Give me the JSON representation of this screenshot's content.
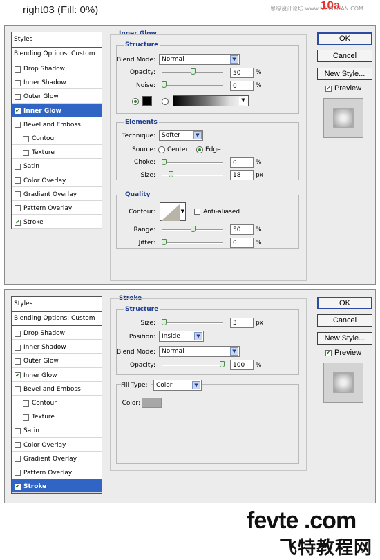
{
  "header": {
    "title": "right03   (Fill: 0%)",
    "watermark": "思缘设计论坛 www.MISSYUAN.COM",
    "number": "10a"
  },
  "colors": {
    "accent": "#3165c5",
    "group_title": "#1f3f8f",
    "check": "#1e6b1e"
  },
  "dialog1": {
    "styles_header": "Styles",
    "blending_options": "Blending Options: Custom",
    "items": [
      {
        "label": "Drop Shadow",
        "checked": false,
        "selected": false
      },
      {
        "label": "Inner Shadow",
        "checked": false,
        "selected": false
      },
      {
        "label": "Outer Glow",
        "checked": false,
        "selected": false
      },
      {
        "label": "Inner Glow",
        "checked": true,
        "selected": true
      },
      {
        "label": "Bevel and Emboss",
        "checked": false,
        "selected": false
      },
      {
        "label": "Contour",
        "checked": false,
        "selected": false,
        "sub": true
      },
      {
        "label": "Texture",
        "checked": false,
        "selected": false,
        "sub": true
      },
      {
        "label": "Satin",
        "checked": false,
        "selected": false
      },
      {
        "label": "Color Overlay",
        "checked": false,
        "selected": false
      },
      {
        "label": "Gradient Overlay",
        "checked": false,
        "selected": false
      },
      {
        "label": "Pattern Overlay",
        "checked": false,
        "selected": false
      },
      {
        "label": "Stroke",
        "checked": true,
        "selected": false
      }
    ],
    "section_title": "Inner Glow",
    "structure": {
      "title": "Structure",
      "blend_mode_label": "Blend Mode:",
      "blend_mode_value": "Normal",
      "opacity_label": "Opacity:",
      "opacity_value": "50",
      "noise_label": "Noise:",
      "noise_value": "0",
      "percent": "%",
      "color_swatch": "#000000"
    },
    "elements": {
      "title": "Elements",
      "technique_label": "Technique:",
      "technique_value": "Softer",
      "source_label": "Source:",
      "source_center": "Center",
      "source_edge": "Edge",
      "choke_label": "Choke:",
      "choke_value": "0",
      "size_label": "Size:",
      "size_value": "18",
      "px": "px",
      "percent": "%"
    },
    "quality": {
      "title": "Quality",
      "contour_label": "Contour:",
      "anti_aliased": "Anti-aliased",
      "range_label": "Range:",
      "range_value": "50",
      "jitter_label": "Jitter:",
      "jitter_value": "0",
      "percent": "%"
    },
    "buttons": {
      "ok": "OK",
      "cancel": "Cancel",
      "new_style": "New Style...",
      "preview": "Preview"
    }
  },
  "dialog2": {
    "styles_header": "Styles",
    "blending_options": "Blending Options: Custom",
    "items": [
      {
        "label": "Drop Shadow",
        "checked": false,
        "selected": false
      },
      {
        "label": "Inner Shadow",
        "checked": false,
        "selected": false
      },
      {
        "label": "Outer Glow",
        "checked": false,
        "selected": false
      },
      {
        "label": "Inner Glow",
        "checked": true,
        "selected": false
      },
      {
        "label": "Bevel and Emboss",
        "checked": false,
        "selected": false
      },
      {
        "label": "Contour",
        "checked": false,
        "selected": false,
        "sub": true
      },
      {
        "label": "Texture",
        "checked": false,
        "selected": false,
        "sub": true
      },
      {
        "label": "Satin",
        "checked": false,
        "selected": false
      },
      {
        "label": "Color Overlay",
        "checked": false,
        "selected": false
      },
      {
        "label": "Gradient Overlay",
        "checked": false,
        "selected": false
      },
      {
        "label": "Pattern Overlay",
        "checked": false,
        "selected": false
      },
      {
        "label": "Stroke",
        "checked": true,
        "selected": true
      }
    ],
    "section_title": "Stroke",
    "structure": {
      "title": "Structure",
      "size_label": "Size:",
      "size_value": "3",
      "px": "px",
      "position_label": "Position:",
      "position_value": "Inside",
      "blend_mode_label": "Blend Mode:",
      "blend_mode_value": "Normal",
      "opacity_label": "Opacity:",
      "opacity_value": "100",
      "percent": "%"
    },
    "fill": {
      "fill_type_label": "Fill Type:",
      "fill_type_value": "Color",
      "color_label": "Color:",
      "color_swatch": "#a7a7a7"
    },
    "buttons": {
      "ok": "OK",
      "cancel": "Cancel",
      "new_style": "New Style...",
      "preview": "Preview"
    }
  },
  "footer": {
    "brand": "fevte .com",
    "cn": "飞特教程网"
  }
}
